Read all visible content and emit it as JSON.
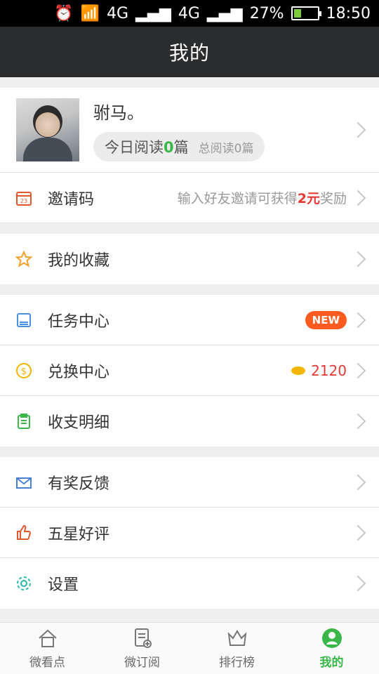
{
  "status_bar": {
    "network_1": "4G",
    "network_2": "4G",
    "battery": "27%",
    "time": "18:50"
  },
  "header": {
    "title": "我的"
  },
  "profile": {
    "name": "驸马。",
    "today_reading_prefix": "今日阅读",
    "today_reading_count": "0",
    "today_reading_suffix": "篇",
    "total_reading": "总阅读0篇"
  },
  "invite": {
    "label": "邀请码",
    "hint_prefix": "输入好友邀请可获得",
    "hint_amount": "2元",
    "hint_suffix": "奖励",
    "icon_text": "23"
  },
  "menu": {
    "favorites": "我的收藏",
    "tasks": "任务中心",
    "tasks_badge": "NEW",
    "exchange": "兑换中心",
    "exchange_coins": "2120",
    "ledger": "收支明细",
    "feedback": "有奖反馈",
    "rating": "五星好评",
    "settings": "设置"
  },
  "bottom_nav": [
    {
      "label": "微看点"
    },
    {
      "label": "微订阅"
    },
    {
      "label": "排行榜"
    },
    {
      "label": "我的"
    }
  ],
  "colors": {
    "accent_green": "#3bb74a",
    "accent_red": "#e53935",
    "header_bg": "#2a2c2e"
  }
}
